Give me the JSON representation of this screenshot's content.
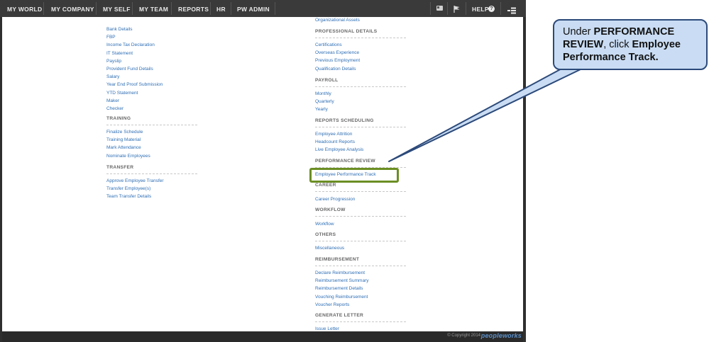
{
  "nav": {
    "items": [
      "MY WORLD",
      "MY COMPANY",
      "MY SELF",
      "MY TEAM",
      "REPORTS",
      "HR",
      "PW ADMIN"
    ],
    "help_label": "HELP"
  },
  "left_column": {
    "top_links": [
      "Bank Details",
      "FBP",
      "Income Tax Declaration",
      "IT Statement",
      "Payslip",
      "Provident Fund Details",
      "Salary",
      "Year End Proof Submission",
      "YTD Statement",
      "Maker",
      "Checker"
    ],
    "sections": [
      {
        "title": "TRAINING",
        "links": [
          "Finalize Schedule",
          "Training Material",
          "Mark Attendance",
          "Nominate Employees"
        ]
      },
      {
        "title": "TRANSFER",
        "links": [
          "Approve Employee Transfer",
          "Transfer Employee(s)",
          "Team Transfer Details"
        ]
      }
    ]
  },
  "right_column": {
    "top_links": [
      "Organizational Assets"
    ],
    "sections": [
      {
        "title": "PROFESSIONAL DETAILS",
        "links": [
          "Certifications",
          "Overseas Experience",
          "Previous Employment",
          "Qualification Details"
        ]
      },
      {
        "title": "PAYROLL",
        "links": [
          "Monthly",
          "Quarterly",
          "Yearly"
        ]
      },
      {
        "title": "REPORTS SCHEDULING",
        "links": [
          "Employee Attrition",
          "Headcount Reports",
          "Live Employee Analysis"
        ]
      },
      {
        "title": "PERFORMANCE REVIEW",
        "links": [
          "Employee Performance Track"
        ]
      },
      {
        "title": "CAREER",
        "links": [
          "Career Progression"
        ]
      },
      {
        "title": "WORKFLOW",
        "links": [
          "Workflow"
        ]
      },
      {
        "title": "OTHERS",
        "links": [
          "Miscellaneous"
        ]
      },
      {
        "title": "REIMBURSEMENT",
        "links": [
          "Declare Reimbursement",
          "Reimbursement Summary",
          "Reimbursement Details",
          "Vouching Reimbursement",
          "Voucher Reports"
        ]
      },
      {
        "title": "GENERATE LETTER",
        "links": [
          "Issue Letter"
        ]
      }
    ]
  },
  "footer": {
    "copyright": "© Copyright 2014",
    "logo": "peopleworks"
  },
  "callout": {
    "text_1": "Under ",
    "text_bold_1": "PERFORMANCE REVIEW",
    "text_2": ", click ",
    "text_bold_2": "Employee Performance Track."
  },
  "colors": {
    "link": "#2f6fb5",
    "nav_bg": "#3a3a3a",
    "highlight": "#6b8e23",
    "callout_bg": "#c9dcf3",
    "callout_border": "#2c4a7a"
  },
  "icons": {
    "nav_right": [
      "id-card-icon",
      "flag-icon",
      "help-circle-icon",
      "menu-tree-icon"
    ]
  }
}
